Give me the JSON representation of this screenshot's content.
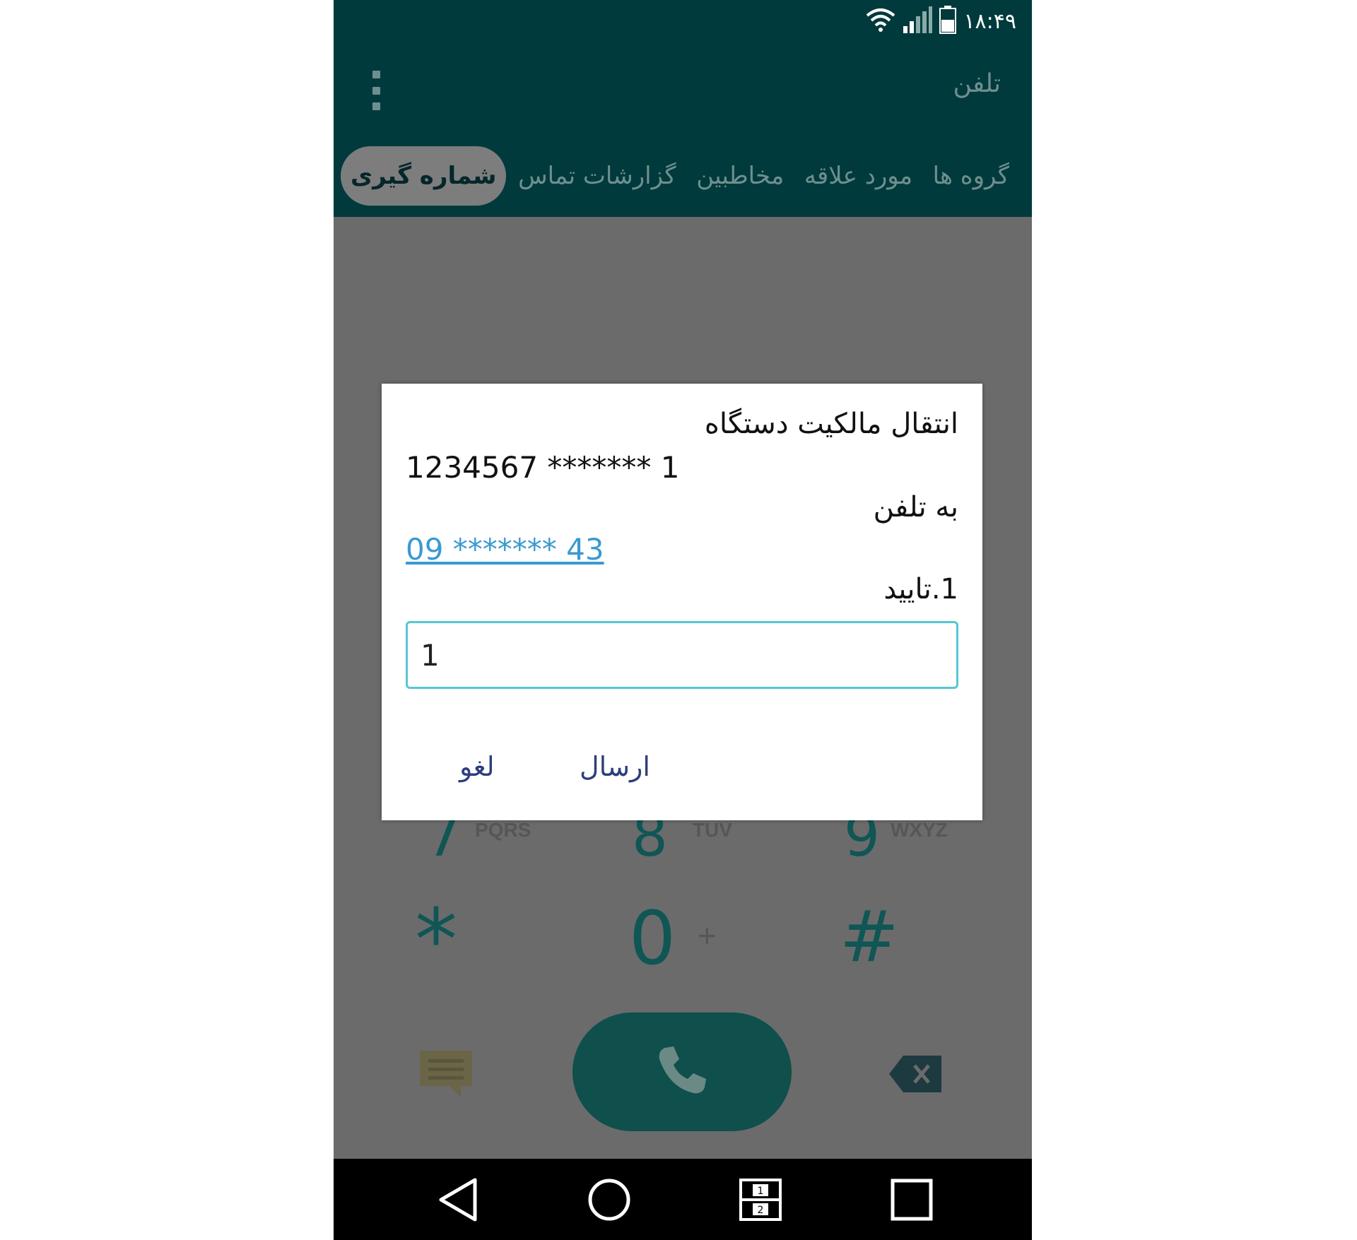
{
  "status": {
    "time": "۱۸:۴۹",
    "icons": [
      "wifi-icon",
      "signal-icon",
      "battery-icon"
    ]
  },
  "appbar": {
    "title": "تلفن",
    "menu_icon": "overflow-menu-icon"
  },
  "tabs": [
    {
      "label": "گروه ها",
      "active": false
    },
    {
      "label": "مورد علاقه",
      "active": false
    },
    {
      "label": "مخاطبین",
      "active": false
    },
    {
      "label": "گزارشات تماس",
      "active": false
    },
    {
      "label": "شماره گیری",
      "active": true
    }
  ],
  "dialpad": {
    "row3": [
      {
        "digit": "7",
        "letters": "PQRS"
      },
      {
        "digit": "8",
        "letters": "TUV"
      },
      {
        "digit": "9",
        "letters": "WXYZ"
      }
    ],
    "row4": [
      {
        "digit": "*",
        "letters": ""
      },
      {
        "digit": "0",
        "letters": "+"
      },
      {
        "digit": "#",
        "letters": ""
      }
    ],
    "message_icon": "message-icon",
    "call_icon": "phone-icon",
    "backspace_icon": "backspace-icon"
  },
  "dialog": {
    "title": "انتقال مالکیت دستگاه",
    "number_line": "1234567 ******* 1",
    "to_phone": "به تلفن",
    "target_phone": "09 ******* 43",
    "option": "1.تایید",
    "input_value": "1",
    "send_label": "ارسال",
    "cancel_label": "لغو"
  },
  "navbar": {
    "icons": [
      "back-icon",
      "home-icon",
      "dual-window-icon",
      "recents-icon"
    ]
  },
  "colors": {
    "header": "#013a3c",
    "dim_overlay": "#6b6b6b",
    "accent": "#56c7d0",
    "link": "#3a9ad0",
    "call_button": "#0f4f4c"
  }
}
